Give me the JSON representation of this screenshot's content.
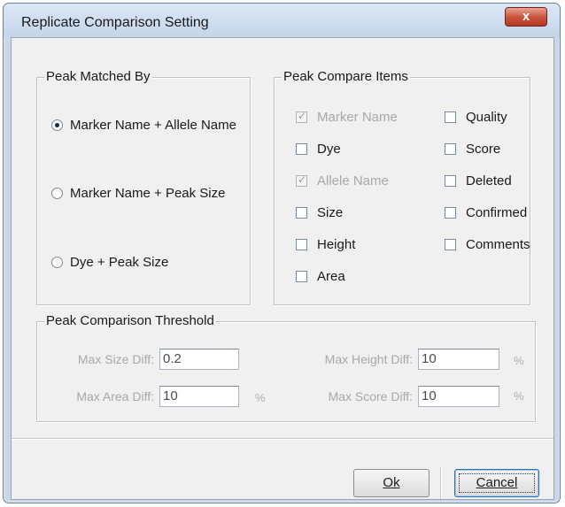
{
  "window": {
    "title": "Replicate Comparison Setting",
    "close_symbol": "x"
  },
  "peak_matched_by": {
    "legend": "Peak Matched By",
    "options": [
      {
        "label": "Marker Name + Allele Name",
        "selected": true
      },
      {
        "label": "Marker Name + Peak Size",
        "selected": false
      },
      {
        "label": "Dye + Peak Size",
        "selected": false
      }
    ]
  },
  "peak_compare_items": {
    "legend": "Peak Compare Items",
    "left": [
      {
        "label": "Marker Name",
        "checked": true,
        "disabled": true
      },
      {
        "label": "Dye",
        "checked": false,
        "disabled": false
      },
      {
        "label": "Allele Name",
        "checked": true,
        "disabled": true
      },
      {
        "label": "Size",
        "checked": false,
        "disabled": false
      },
      {
        "label": "Height",
        "checked": false,
        "disabled": false
      },
      {
        "label": "Area",
        "checked": false,
        "disabled": false
      }
    ],
    "right": [
      {
        "label": "Quality",
        "checked": false,
        "disabled": false
      },
      {
        "label": "Score",
        "checked": false,
        "disabled": false
      },
      {
        "label": "Deleted",
        "checked": false,
        "disabled": false
      },
      {
        "label": "Confirmed",
        "checked": false,
        "disabled": false
      },
      {
        "label": "Comments",
        "checked": false,
        "disabled": false
      }
    ]
  },
  "threshold": {
    "legend": "Peak Comparison Threshold",
    "max_size_diff": {
      "label": "Max Size Diff:",
      "value": "0.2"
    },
    "max_area_diff": {
      "label": "Max Area Diff:",
      "value": "10",
      "unit": "%"
    },
    "max_height_diff": {
      "label": "Max Height Diff:",
      "value": "10",
      "unit": "%"
    },
    "max_score_diff": {
      "label": "Max Score Diff:",
      "value": "10",
      "unit": "%"
    }
  },
  "buttons": {
    "ok": "Ok",
    "cancel": "Cancel"
  }
}
